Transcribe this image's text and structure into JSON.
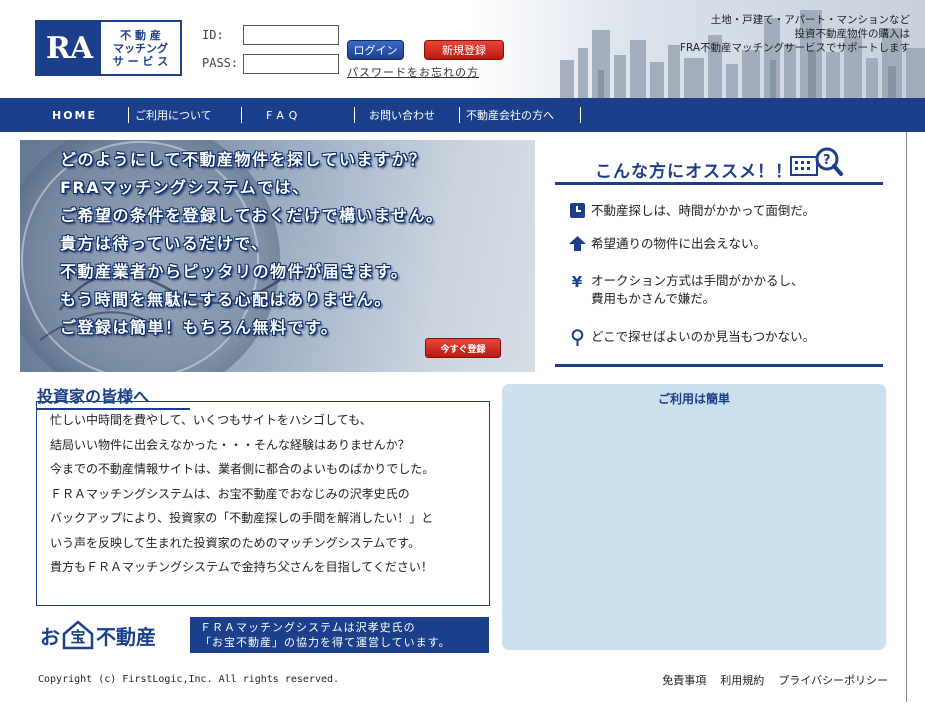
{
  "header": {
    "logo": {
      "mark": "RA",
      "line1": "不 動 産",
      "line2": "マッチング",
      "line3": "サ ー ビ ス"
    },
    "login": {
      "id_label": "ID:",
      "pass_label": "PASS:",
      "id_value": "",
      "pass_value": "",
      "login_button": "ログイン",
      "register_button": "新規登録",
      "forgot_link": "パスワードをお忘れの方"
    },
    "catch": {
      "line1": "土地・戸建て・アパート・マンションなど",
      "line2": "投資不動産物件の購入は",
      "line3": "FRA不動産マッチングサービスでサポートします"
    }
  },
  "nav": {
    "items": [
      {
        "label": "HOME"
      },
      {
        "label": "ご利用について"
      },
      {
        "label": "FAQ"
      },
      {
        "label": "お問い合わせ"
      },
      {
        "label": "不動産会社の方へ"
      }
    ]
  },
  "hero": {
    "lines": [
      "どのようにして不動産物件を探していますか？",
      "FRAマッチングシステムでは、",
      "ご希望の条件を登録しておくだけで構いません。",
      "貴方は待っているだけで、",
      "不動産業者からピッタリの物件が届きます。",
      "もう時間を無駄にする心配はありません。",
      "ご登録は簡単！もちろん無料です。"
    ],
    "register_button": "今すぐ登録"
  },
  "recommend": {
    "title": "こんな方にオススメ！！",
    "items": [
      {
        "icon": "clock-icon",
        "lines": [
          "不動産探しは、時間がかかって面倒だ。"
        ]
      },
      {
        "icon": "arrow-up-icon",
        "lines": [
          "希望通りの物件に出会えない。"
        ]
      },
      {
        "icon": "yen-icon",
        "glyph": "¥",
        "lines": [
          "オークション方式は手間がかかるし、",
          "費用もかさんで嫌だ。"
        ]
      },
      {
        "icon": "map-pin-icon",
        "lines": [
          "どこで探せばよいのか見当もつかない。"
        ]
      }
    ]
  },
  "investor": {
    "heading": "投資家の皆様へ",
    "lines": [
      "忙しい中時間を費やして、いくつもサイトをハシゴしても、",
      "結局いい物件に出会えなかった・・・そんな経験はありませんか？",
      "今までの不動産情報サイトは、業者側に都合のよいものばかりでした。",
      "ＦＲＡマッチングシステムは、お宝不動産でおなじみの沢孝史氏の",
      "バックアップにより、投資家の「不動産探しの手間を解消したい！」と",
      "いう声を反映して生まれた投資家のためのマッチングシステムです。",
      "貴方もＦＲＡマッチングシステムで金持ち父さんを目指してください！"
    ]
  },
  "otakara": {
    "logo_prefix": "お",
    "logo_mark": "宝",
    "logo_suffix": "不動産",
    "banner_line1": "ＦＲＡマッチングシステムは沢孝史氏の",
    "banner_line2": "「お宝不動産」の協力を得て運営しています。"
  },
  "usage": {
    "title": "ご利用は簡単"
  },
  "footer": {
    "copyright": "Copyright (c) FirstLogic,Inc. All rights reserved.",
    "links": [
      "免責事項",
      "利用規約",
      "プライバシーポリシー"
    ]
  },
  "colors": {
    "brand_navy": "#1b3f8a",
    "accent_red": "#c8231a",
    "panel_blue": "#cde0ee"
  }
}
